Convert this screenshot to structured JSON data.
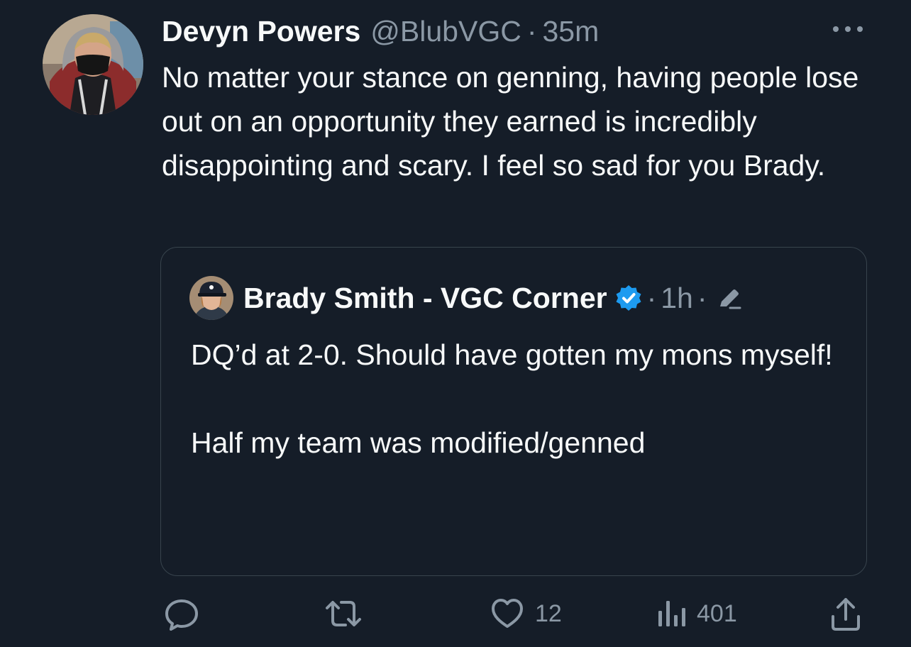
{
  "tweet": {
    "author_name": "Devyn Powers",
    "author_handle": "@BlubVGC",
    "separator": "·",
    "time": "35m",
    "more_icon": "more-horizontal-icon",
    "text": "No matter your stance on genning, having people lose out on an opportunity they earned is incredibly disappointing and scary. I feel so sad for you Brady."
  },
  "quote": {
    "author_name": "Brady Smith - VGC Corner",
    "verified_icon": "verified-badge-icon",
    "separator": "·",
    "time": "1h",
    "edited_icon": "edit-pencil-icon",
    "text": "DQ’d at 2-0. Should have gotten my mons myself!\n\nHalf my team was modified/genned"
  },
  "actions": {
    "reply": {
      "icon": "reply-icon",
      "count": ""
    },
    "retweet": {
      "icon": "retweet-icon",
      "count": ""
    },
    "like": {
      "icon": "heart-icon",
      "count": "12"
    },
    "views": {
      "icon": "views-bar-chart-icon",
      "count": "401"
    },
    "share": {
      "icon": "share-icon"
    }
  },
  "colors": {
    "background": "#151d28",
    "primary_text": "#f7f9f9",
    "secondary_text": "#8b98a5",
    "border": "#38444d",
    "verified_blue": "#1d9bf0"
  }
}
